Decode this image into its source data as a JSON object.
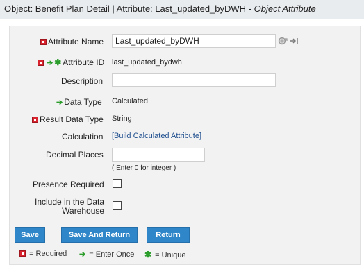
{
  "title": {
    "prefix": "Object: Benefit Plan Detail | Attribute: Last_updated_byDWH - ",
    "suffix": "Object Attribute"
  },
  "form": {
    "attribute_name": {
      "label": "Attribute Name",
      "value": "Last_updated_byDWH"
    },
    "attribute_id": {
      "label": "Attribute ID",
      "value": "last_updated_bydwh"
    },
    "description": {
      "label": "Description",
      "value": ""
    },
    "data_type": {
      "label": "Data Type",
      "value": "Calculated"
    },
    "result_data_type": {
      "label": "Result Data Type",
      "value": "String"
    },
    "calculation": {
      "label": "Calculation",
      "link": "[Build Calculated Attribute]"
    },
    "decimal_places": {
      "label": "Decimal Places",
      "value": "",
      "hint": "( Enter 0 for integer )"
    },
    "presence_required": {
      "label": "Presence Required",
      "checked": false
    },
    "include_dw": {
      "label_line1": "Include in the Data",
      "label_line2": "Warehouse",
      "checked": false
    }
  },
  "buttons": {
    "save": "Save",
    "save_and_return": "Save And Return",
    "return": "Return"
  },
  "legend": {
    "required": "= Required",
    "enter_once": "= Enter Once",
    "unique": "= Unique"
  },
  "colors": {
    "required_marker": "#d9232e",
    "enter_once_marker": "#2a9d2a",
    "button": "#2f86c8"
  }
}
